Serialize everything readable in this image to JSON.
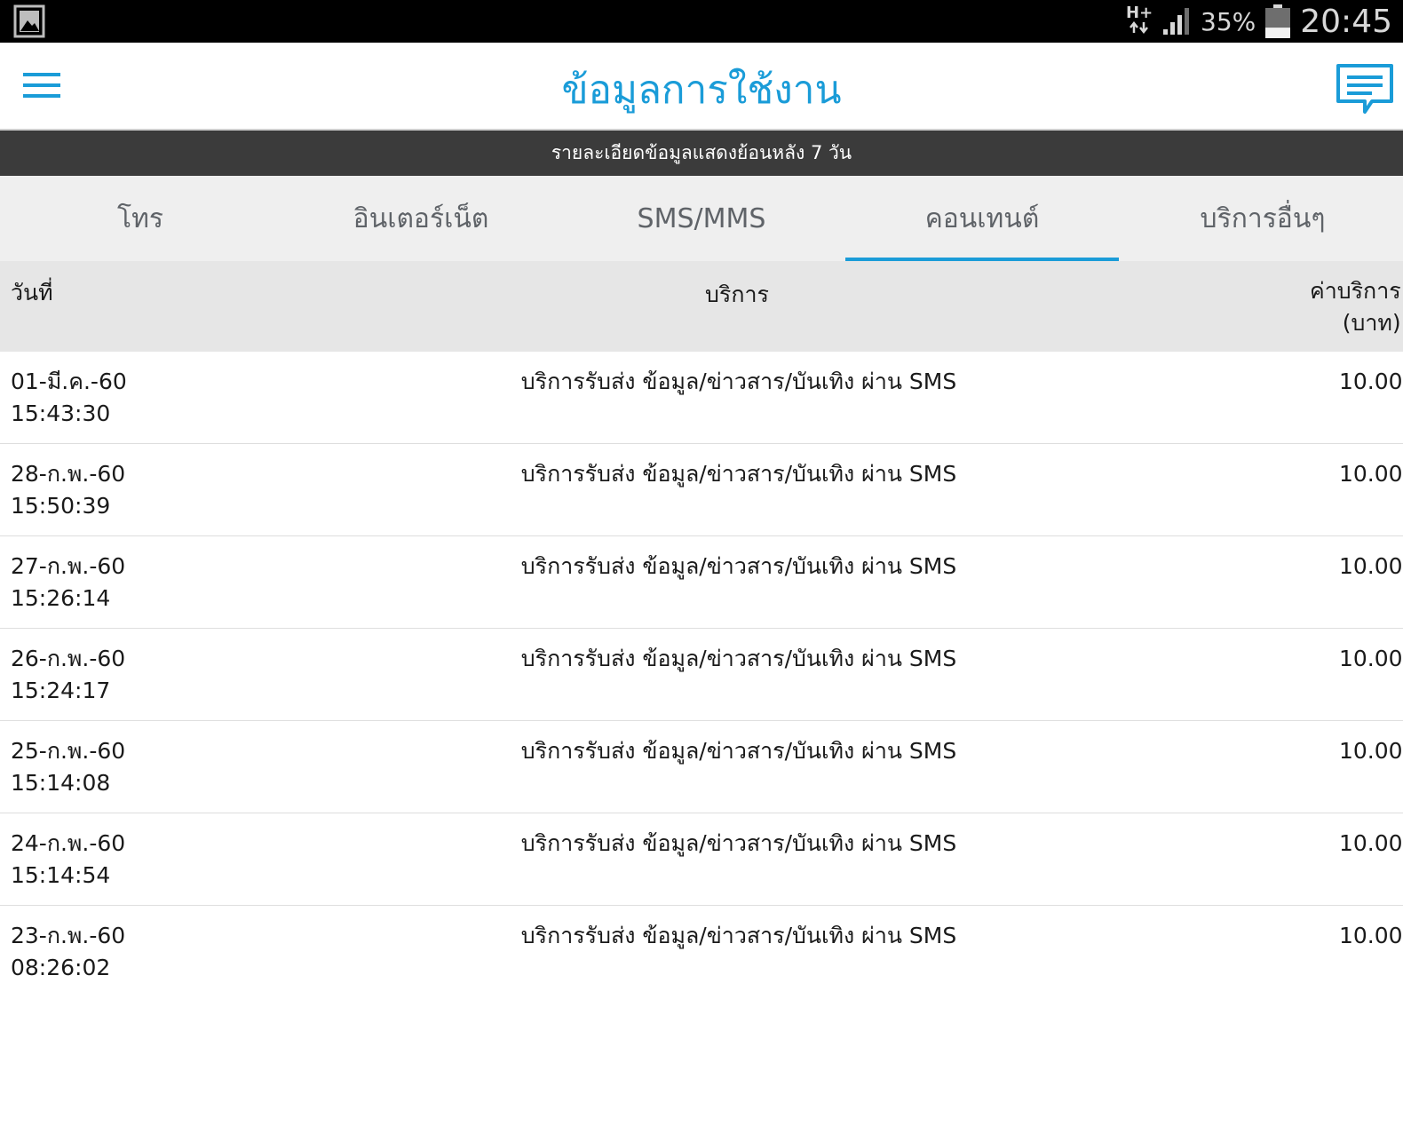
{
  "status_bar": {
    "network": "H+",
    "battery_percent": "35%",
    "battery_level": 0.35,
    "clock": "20:45",
    "icons": [
      "gallery-icon",
      "data-arrows-icon",
      "signal-icon",
      "battery-icon"
    ]
  },
  "app_bar": {
    "title": "ข้อมูลการใช้งาน",
    "menu_icon": "hamburger-menu-icon",
    "message_icon": "message-bubble-icon"
  },
  "banner": {
    "text": "รายละเอียดข้อมูลแสดงย้อนหลัง 7 วัน"
  },
  "tabs": [
    {
      "label": "โทร",
      "active": false
    },
    {
      "label": "อินเตอร์เน็ต",
      "active": false
    },
    {
      "label": "SMS/MMS",
      "active": false
    },
    {
      "label": "คอนเทนต์",
      "active": true
    },
    {
      "label": "บริการอื่นๆ",
      "active": false
    }
  ],
  "table": {
    "headers": {
      "date": "วันที่",
      "service": "บริการ",
      "charge_line1": "ค่าบริการ",
      "charge_line2": "(บาท)"
    },
    "rows": [
      {
        "date": "01-มี.ค.-60",
        "time": "15:43:30",
        "service": "บริการรับส่ง ข้อมูล/ข่าวสาร/บันเทิง ผ่าน SMS",
        "charge": "10.00"
      },
      {
        "date": "28-ก.พ.-60",
        "time": "15:50:39",
        "service": "บริการรับส่ง ข้อมูล/ข่าวสาร/บันเทิง ผ่าน SMS",
        "charge": "10.00"
      },
      {
        "date": "27-ก.พ.-60",
        "time": "15:26:14",
        "service": "บริการรับส่ง ข้อมูล/ข่าวสาร/บันเทิง ผ่าน SMS",
        "charge": "10.00"
      },
      {
        "date": "26-ก.พ.-60",
        "time": "15:24:17",
        "service": "บริการรับส่ง ข้อมูล/ข่าวสาร/บันเทิง ผ่าน SMS",
        "charge": "10.00"
      },
      {
        "date": "25-ก.พ.-60",
        "time": "15:14:08",
        "service": "บริการรับส่ง ข้อมูล/ข่าวสาร/บันเทิง ผ่าน SMS",
        "charge": "10.00"
      },
      {
        "date": "24-ก.พ.-60",
        "time": "15:14:54",
        "service": "บริการรับส่ง ข้อมูล/ข่าวสาร/บันเทิง ผ่าน SMS",
        "charge": "10.00"
      },
      {
        "date": "23-ก.พ.-60",
        "time": "08:26:02",
        "service": "บริการรับส่ง ข้อมูล/ข่าวสาร/บันเทิง ผ่าน SMS",
        "charge": "10.00"
      }
    ]
  },
  "colors": {
    "accent": "#1a9cd8",
    "banner_bg": "#3b3b3b",
    "tabs_bg": "#efefef",
    "header_bg": "#e6e6e6",
    "status_bar_bg": "#000000"
  }
}
